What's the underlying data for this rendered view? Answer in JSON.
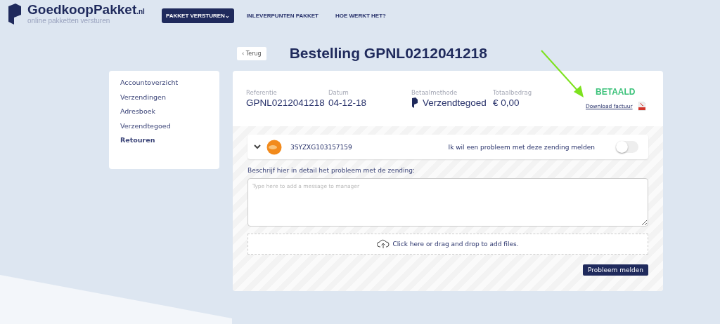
{
  "logo": {
    "name": "GoedkoopPakket",
    "tld": ".nl",
    "tagline": "online pakketten versturen"
  },
  "nav": [
    {
      "label": "PAKKET VERSTUREN",
      "selected": true,
      "caret": "⌄"
    },
    {
      "label": "INLEVERPUNTEN PAKKET",
      "selected": false
    },
    {
      "label": "HOE WERKT HET?",
      "selected": false
    }
  ],
  "back_button": "‹ Terug",
  "title": "Bestelling GPNL0212041218",
  "sidebar": {
    "items": [
      {
        "label": "Accountoverzicht",
        "selected": false
      },
      {
        "label": "Verzendingen",
        "selected": false
      },
      {
        "label": "Adresboek",
        "selected": false
      },
      {
        "label": "Verzendtegoed",
        "selected": false
      },
      {
        "label": "Retouren",
        "selected": true
      }
    ]
  },
  "order": {
    "fields": [
      {
        "label": "Referentie",
        "value": "GPNL0212041218",
        "kind": "text"
      },
      {
        "label": "Datum",
        "value": "04-12-18",
        "kind": "text"
      },
      {
        "label": "Betaalmethode",
        "value": "Verzendtegoed",
        "kind": "payment"
      },
      {
        "label": "Totaalbedrag",
        "value": "€ 0,00",
        "kind": "text"
      }
    ],
    "status": "BETAALD",
    "download_link": "Download factuur"
  },
  "shipment": {
    "tracking": "3SYZXG103157159",
    "toggle_label": "Ik wil een probleem met deze zending melden",
    "toggle_on": false
  },
  "problem_form": {
    "label": "Beschrijf hier in detail het probleem met de zending:",
    "placeholder": "Type here to add a message to manager",
    "upload_text": "Click here or drag and drop to add files.",
    "submit": "Probleem melden"
  }
}
